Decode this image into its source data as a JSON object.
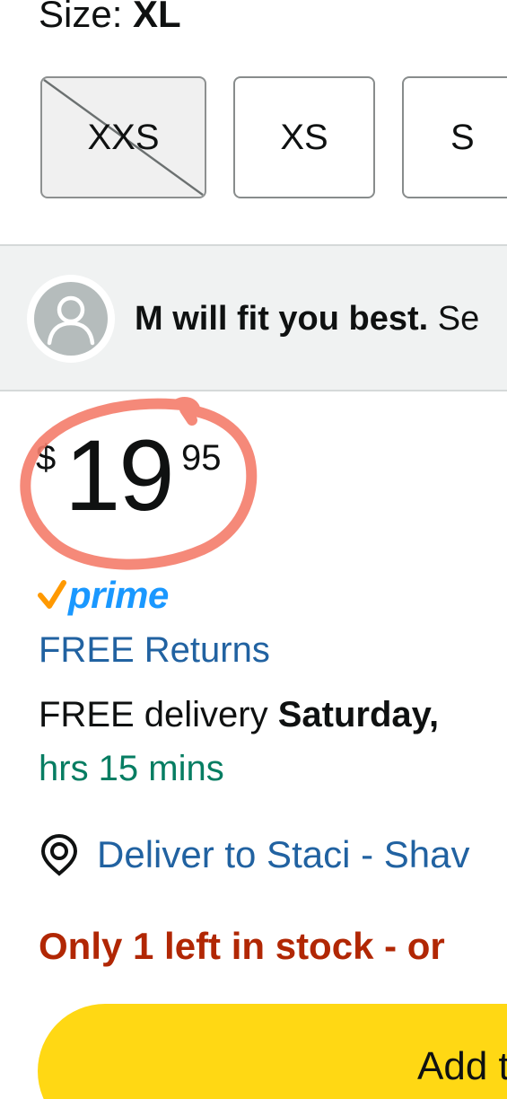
{
  "size": {
    "label": "Size: ",
    "selected": "XL",
    "options": [
      {
        "label": "XXS",
        "available": false
      },
      {
        "label": "XS",
        "available": true
      },
      {
        "label": "S",
        "available": true
      }
    ]
  },
  "fit": {
    "bold_text": "M will fit you best.",
    "trailing_text": " Se"
  },
  "price": {
    "symbol": "$",
    "whole": "19",
    "fraction": "95",
    "annotation_color": "#f47c6a"
  },
  "prime": {
    "check": "✓",
    "word": "prime",
    "color": "#1a98ff",
    "check_color": "#ff9900"
  },
  "returns": "FREE Returns",
  "delivery": {
    "prefix": "FREE delivery ",
    "bold": "Saturday,",
    "countdown": "hrs 15 mins"
  },
  "deliver_to": "Deliver to Staci - Shav",
  "stock": "Only 1 left in stock - or",
  "add_button": {
    "label": "Add t",
    "color": "#ffd814"
  },
  "icons": {
    "avatar": "user-silhouette-icon",
    "location": "location-pin-icon"
  }
}
